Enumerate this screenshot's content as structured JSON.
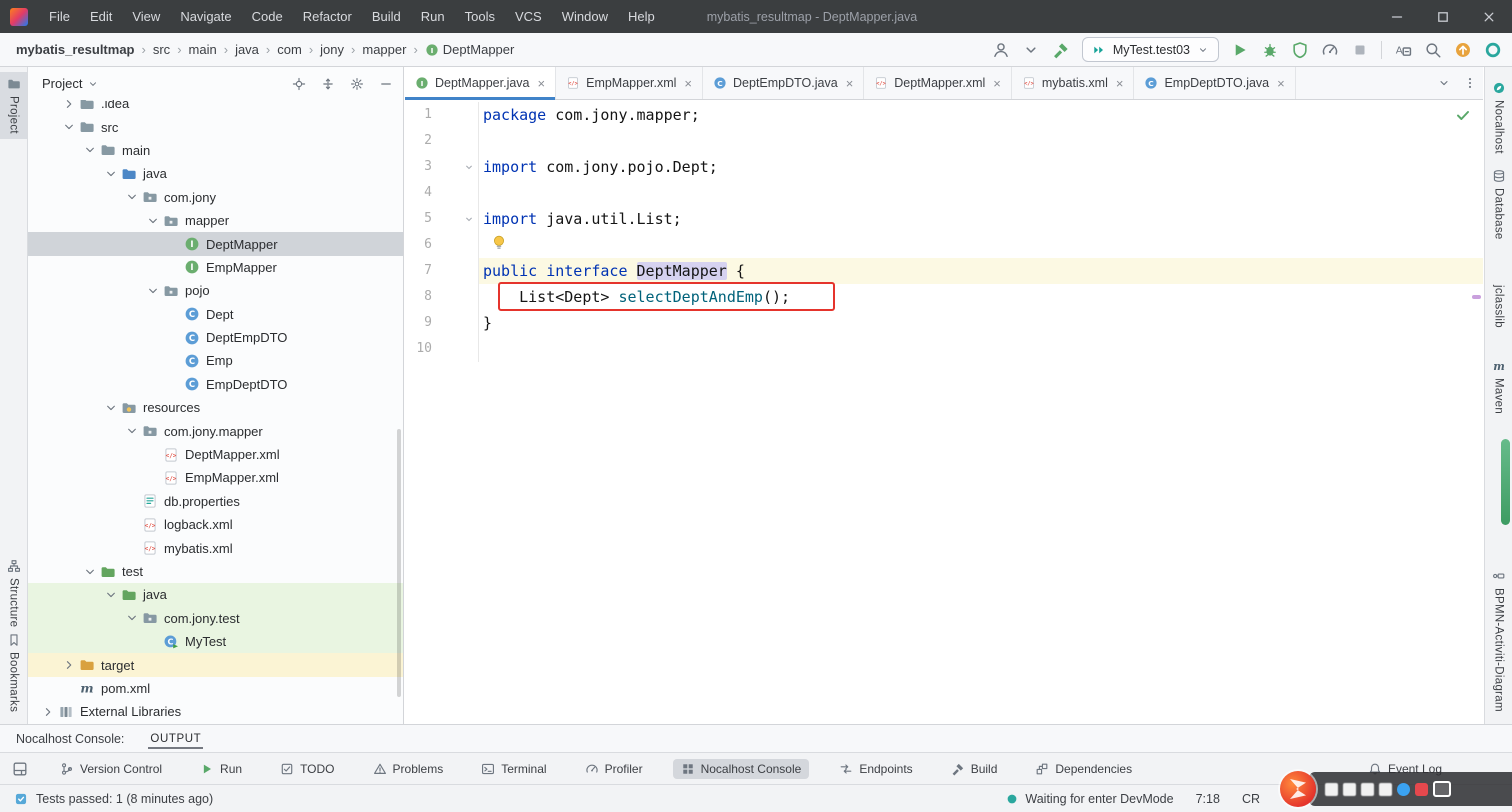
{
  "titlebar": {
    "title": "mybatis_resultmap - DeptMapper.java",
    "menus": [
      "File",
      "Edit",
      "View",
      "Navigate",
      "Code",
      "Refactor",
      "Build",
      "Run",
      "Tools",
      "VCS",
      "Window",
      "Help"
    ],
    "window_buttons": [
      "minimize",
      "maximize",
      "close"
    ]
  },
  "navbar": {
    "breadcrumbs": [
      {
        "label": "mybatis_resultmap",
        "bold": true
      },
      {
        "label": "src"
      },
      {
        "label": "main"
      },
      {
        "label": "java"
      },
      {
        "label": "com"
      },
      {
        "label": "jony"
      },
      {
        "label": "mapper"
      },
      {
        "label": "DeptMapper",
        "icon": "interface"
      }
    ],
    "run_config": {
      "label": "MyTest.test03"
    },
    "icons_left": [
      "user",
      "caret",
      "hammer"
    ],
    "icons_right": [
      "play",
      "bug",
      "coverage",
      "profiler",
      "stop",
      "separator",
      "translate",
      "search",
      "update",
      "nocalhost-ring"
    ]
  },
  "left_stripe": [
    {
      "label": "Project",
      "icon": "project-folder",
      "active": true
    },
    {
      "label": "Structure",
      "icon": "structure"
    },
    {
      "label": "Bookmarks",
      "icon": "bookmark"
    }
  ],
  "right_stripe": [
    {
      "label": "Nocalhost",
      "icon": "nocalhost-leaf"
    },
    {
      "label": "Database",
      "icon": "database"
    },
    {
      "label": "jclasslib",
      "icon": null
    },
    {
      "label": "Maven",
      "icon": "maven"
    },
    {
      "label": "BPMN-Activiti-Diagram",
      "icon": "bpmn"
    }
  ],
  "project": {
    "header": {
      "title": "Project",
      "icons": [
        "locate",
        "collapse",
        "gear",
        "minus"
      ]
    },
    "tree": [
      {
        "label": ".idea",
        "depth": 1,
        "icon": "folder",
        "chevron": "right"
      },
      {
        "label": "src",
        "depth": 1,
        "icon": "folder",
        "chevron": "down"
      },
      {
        "label": "main",
        "depth": 2,
        "icon": "folder",
        "chevron": "down"
      },
      {
        "label": "java",
        "depth": 3,
        "icon": "folder-source",
        "chevron": "down"
      },
      {
        "label": "com.jony",
        "depth": 4,
        "icon": "package",
        "chevron": "down"
      },
      {
        "label": "mapper",
        "depth": 5,
        "icon": "package",
        "chevron": "down"
      },
      {
        "label": "DeptMapper",
        "depth": 6,
        "icon": "interface",
        "bg": "selected"
      },
      {
        "label": "EmpMapper",
        "depth": 6,
        "icon": "interface"
      },
      {
        "label": "pojo",
        "depth": 5,
        "icon": "package",
        "chevron": "down"
      },
      {
        "label": "Dept",
        "depth": 6,
        "icon": "class"
      },
      {
        "label": "DeptEmpDTO",
        "depth": 6,
        "icon": "class"
      },
      {
        "label": "Emp",
        "depth": 6,
        "icon": "class"
      },
      {
        "label": "EmpDeptDTO",
        "depth": 6,
        "icon": "class"
      },
      {
        "label": "resources",
        "depth": 3,
        "icon": "folder-resources",
        "chevron": "down"
      },
      {
        "label": "com.jony.mapper",
        "depth": 4,
        "icon": "package",
        "chevron": "down"
      },
      {
        "label": "DeptMapper.xml",
        "depth": 5,
        "icon": "xml"
      },
      {
        "label": "EmpMapper.xml",
        "depth": 5,
        "icon": "xml"
      },
      {
        "label": "db.properties",
        "depth": 4,
        "icon": "properties"
      },
      {
        "label": "logback.xml",
        "depth": 4,
        "icon": "xml"
      },
      {
        "label": "mybatis.xml",
        "depth": 4,
        "icon": "xml"
      },
      {
        "label": "test",
        "depth": 2,
        "icon": "folder-test",
        "chevron": "down"
      },
      {
        "label": "java",
        "depth": 3,
        "icon": "folder-test",
        "chevron": "down",
        "bg": "green"
      },
      {
        "label": "com.jony.test",
        "depth": 4,
        "icon": "package",
        "chevron": "down",
        "bg": "green"
      },
      {
        "label": "MyTest",
        "depth": 5,
        "icon": "class-test",
        "bg": "green"
      },
      {
        "label": "target",
        "depth": 1,
        "icon": "folder-excluded",
        "chevron": "right",
        "bg": "yellow"
      },
      {
        "label": "pom.xml",
        "depth": 1,
        "icon": "maven"
      },
      {
        "label": "External Libraries",
        "depth": 0,
        "icon": "library",
        "chevron": "right"
      }
    ]
  },
  "editor": {
    "tabs": [
      {
        "label": "DeptMapper.java",
        "icon": "interface",
        "active": true
      },
      {
        "label": "EmpMapper.xml",
        "icon": "xml"
      },
      {
        "label": "DeptEmpDTO.java",
        "icon": "class"
      },
      {
        "label": "DeptMapper.xml",
        "icon": "xml"
      },
      {
        "label": "mybatis.xml",
        "icon": "xml"
      },
      {
        "label": "EmpDeptDTO.java",
        "icon": "class"
      }
    ],
    "tabs_extra_icons": [
      "caret",
      "kebab"
    ],
    "lines": [
      {
        "num": 1,
        "tokens": [
          {
            "t": "package",
            "c": "kw"
          },
          {
            "t": " com.jony.mapper;",
            "c": "pl"
          }
        ]
      },
      {
        "num": 2,
        "tokens": []
      },
      {
        "num": 3,
        "fold": true,
        "tokens": [
          {
            "t": "import",
            "c": "kw"
          },
          {
            "t": " com.jony.pojo.Dept;",
            "c": "pl"
          }
        ]
      },
      {
        "num": 4,
        "tokens": []
      },
      {
        "num": 5,
        "fold": true,
        "tokens": [
          {
            "t": "import",
            "c": "kw"
          },
          {
            "t": " java.util.List;",
            "c": "pl"
          }
        ]
      },
      {
        "num": 6,
        "bulb": true,
        "tokens": []
      },
      {
        "num": 7,
        "caret": true,
        "tokens": [
          {
            "t": "public",
            "c": "kw"
          },
          {
            "t": " ",
            "c": "pl"
          },
          {
            "t": "interface",
            "c": "kw"
          },
          {
            "t": " ",
            "c": "pl"
          },
          {
            "t": "DeptMapper",
            "c": "pl idhl"
          },
          {
            "t": " {",
            "c": "pl"
          }
        ]
      },
      {
        "num": 8,
        "tokens": [
          {
            "t": "    List<Dept> ",
            "c": "pl"
          },
          {
            "t": "selectDeptAndEmp",
            "c": "method"
          },
          {
            "t": "();",
            "c": "pl"
          }
        ]
      },
      {
        "num": 9,
        "tokens": [
          {
            "t": "}",
            "c": "pl"
          }
        ]
      },
      {
        "num": 10,
        "tokens": []
      }
    ],
    "inspection_status": "ok"
  },
  "console": {
    "label": "Nocalhost Console:",
    "tab": "OUTPUT",
    "icons": [
      "gear",
      "minus"
    ]
  },
  "bottombar": {
    "items": [
      {
        "label": "Version Control",
        "icon": "branch"
      },
      {
        "label": "Run",
        "icon": "run-small"
      },
      {
        "label": "TODO",
        "icon": "todo"
      },
      {
        "label": "Problems",
        "icon": "problems"
      },
      {
        "label": "Terminal",
        "icon": "terminal"
      },
      {
        "label": "Profiler",
        "icon": "profiler"
      },
      {
        "label": "Nocalhost Console",
        "icon": "cluster",
        "active": true
      },
      {
        "label": "Endpoints",
        "icon": "endpoints"
      },
      {
        "label": "Build",
        "icon": "hammer-gray"
      },
      {
        "label": "Dependencies",
        "icon": "deps"
      }
    ],
    "right": [
      {
        "label": "Event Log",
        "icon": "bell"
      }
    ]
  },
  "statusbar": {
    "left": {
      "icon": "test-widget",
      "text": "Tests passed: 1 (8 minutes ago)"
    },
    "right": [
      {
        "icon": "nocalhost-small",
        "text": "Waiting for enter DevMode"
      },
      {
        "text": "7:18"
      },
      {
        "text": "CR"
      }
    ]
  },
  "watermark": {
    "present": true,
    "icons": [
      "logo",
      "blue-dot",
      "red-dot",
      "white-box"
    ]
  },
  "colors": {
    "keyword": "#0033B3",
    "method": "#00627A",
    "annotation_box": "#E5342C",
    "selected_row": "#D0D4D9",
    "test_row_green": "#E9F5E1",
    "excluded_row_yellow": "#FBF4D4",
    "run_green": "#59A869",
    "tab_underline": "#4083C9"
  }
}
